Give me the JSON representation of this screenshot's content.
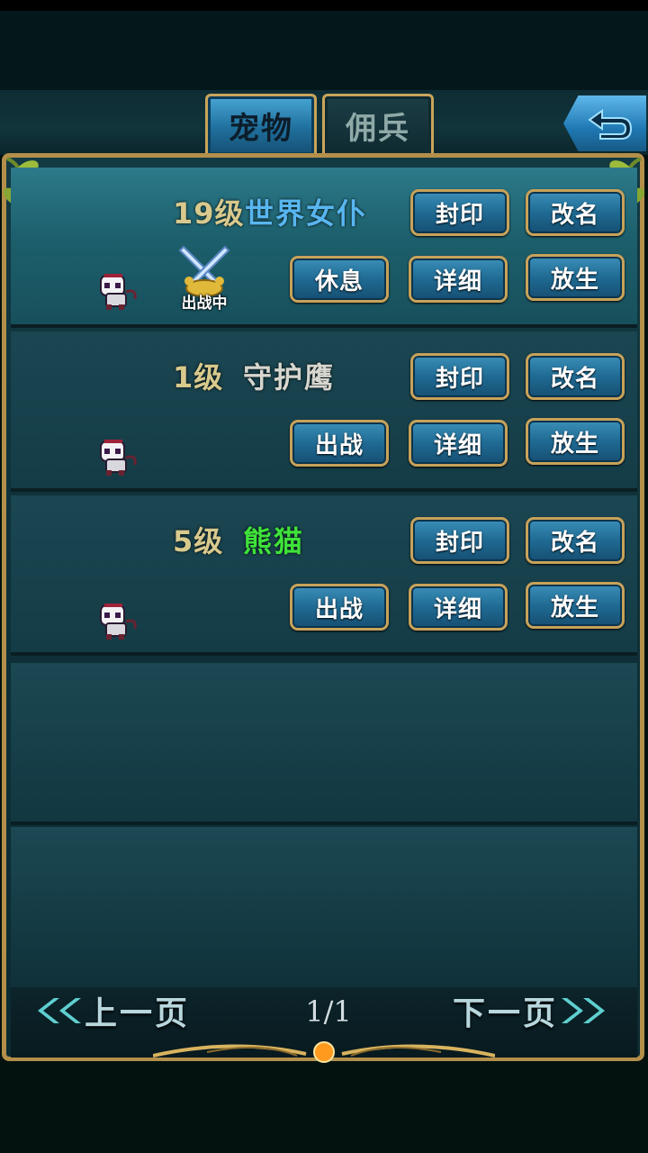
{
  "tabs": [
    {
      "label": "宠物",
      "active": true
    },
    {
      "label": "佣兵",
      "active": false
    }
  ],
  "back_icon": "return-arrow-icon",
  "pets": [
    {
      "level": "19级",
      "name": "世界女仆",
      "name_color": "#58b6f0",
      "status_label": "出战中",
      "status_icon": "crossed-swords-icon",
      "buttons": {
        "seal": "封印",
        "rename": "改名",
        "action": "休息",
        "detail": "详细",
        "release": "放生"
      }
    },
    {
      "level": "1级",
      "name": "守护鹰",
      "name_color": "#d6d6cf",
      "buttons": {
        "seal": "封印",
        "rename": "改名",
        "action": "出战",
        "detail": "详细",
        "release": "放生"
      }
    },
    {
      "level": "5级",
      "name": "熊猫",
      "name_color": "#3fe23a",
      "buttons": {
        "seal": "封印",
        "rename": "改名",
        "action": "出战",
        "detail": "详细",
        "release": "放生"
      }
    }
  ],
  "pagination": {
    "prev": "上一页",
    "page": "1/1",
    "next": "下一页"
  },
  "colors": {
    "accent_gold": "#c7a25a",
    "button_blue": "#1f6a93",
    "panel": "#133a43"
  }
}
